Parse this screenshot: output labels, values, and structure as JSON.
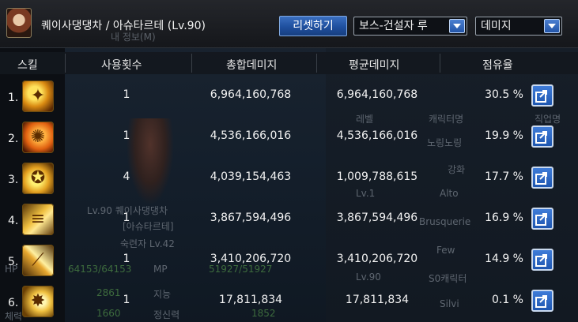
{
  "header": {
    "character_title": "퀘이사댕댕차 / 아슈타르테 (Lv.90)",
    "reset_button": "리셋하기",
    "boss_select_value": "보스-건설자 루",
    "metric_select_value": "데미지"
  },
  "columns": {
    "skill": "스킬",
    "uses": "사용횟수",
    "total_damage": "총합데미지",
    "avg_damage": "평균데미지",
    "share": "점유율"
  },
  "rows": [
    {
      "rank": "1.",
      "icon": "skill-1-icon",
      "uses": "1",
      "total": "6,964,160,768",
      "avg": "6,964,160,768",
      "share": "30.5 %"
    },
    {
      "rank": "2.",
      "icon": "skill-2-icon",
      "uses": "1",
      "total": "4,536,166,016",
      "avg": "4,536,166,016",
      "share": "19.9 %"
    },
    {
      "rank": "3.",
      "icon": "skill-3-icon",
      "uses": "4",
      "total": "4,039,154,463",
      "avg": "1,009,788,615",
      "share": "17.7 %"
    },
    {
      "rank": "4.",
      "icon": "skill-4-icon",
      "uses": "1",
      "total": "3,867,594,496",
      "avg": "3,867,594,496",
      "share": "16.9 %"
    },
    {
      "rank": "5.",
      "icon": "skill-5-icon",
      "uses": "1",
      "total": "3,410,206,720",
      "avg": "3,410,206,720",
      "share": "14.9 %"
    },
    {
      "rank": "6.",
      "icon": "skill-6-icon",
      "uses": "1",
      "total": "17,811,834",
      "avg": "17,811,834",
      "share": "0.1 %"
    }
  ],
  "background_text": {
    "info_label": "내 정보(M)",
    "level_line": "Lv.90 퀘이사댕댕차",
    "class_line": "[아슈타르테]",
    "mastery_line": "숙련자 Lv.42",
    "hp_label": "HP",
    "hp_value": "64153/64153",
    "mp_label": "MP",
    "mp_value": "51927/51927",
    "stat_int": "2861",
    "stat_int_label": "지능",
    "stat_spirit": "1660",
    "stat_spirit_label": "정신력",
    "stat_extra": "1852",
    "stat_body_label": "체력",
    "list_level": "레벨",
    "list_char": "캐릭터명",
    "list_job": "직업명",
    "list_name_1": "노링노링",
    "list_name_2": "강화",
    "list_name_3": "Alto",
    "list_name_4": "Brusquerie",
    "list_name_5": "Few",
    "list_name_6": "S0캐릭터",
    "list_name_7": "Silvi",
    "list_lv_1": "Lv.1",
    "list_lv_2": "Lv.90"
  },
  "colors": {
    "accent_blue": "#2355a8",
    "background": "#0c0f14",
    "text": "#f2f2f2"
  }
}
